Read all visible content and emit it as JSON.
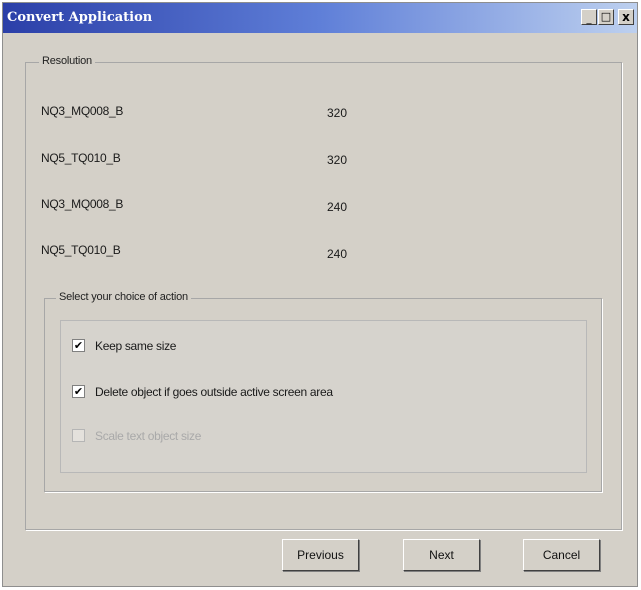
{
  "window": {
    "title": "Convert Application",
    "controls": {
      "minimize": "_",
      "maximize": "□",
      "close": "x"
    }
  },
  "resolution": {
    "legend": "Resolution",
    "rows": [
      {
        "name": "NQ3_MQ008_B",
        "value": "320"
      },
      {
        "name": "NQ5_TQ010_B",
        "value": "320"
      },
      {
        "name": "NQ3_MQ008_B",
        "value": "240"
      },
      {
        "name": "NQ5_TQ010_B",
        "value": "240"
      }
    ]
  },
  "action": {
    "legend": "Select your choice of action",
    "options": [
      {
        "label": "Keep same size",
        "checked": true,
        "enabled": true
      },
      {
        "label": "Delete object if goes outside active screen area",
        "checked": true,
        "enabled": true
      },
      {
        "label": "Scale text object size",
        "checked": false,
        "enabled": false
      }
    ]
  },
  "buttons": {
    "previous": "Previous",
    "next": "Next",
    "cancel": "Cancel"
  }
}
